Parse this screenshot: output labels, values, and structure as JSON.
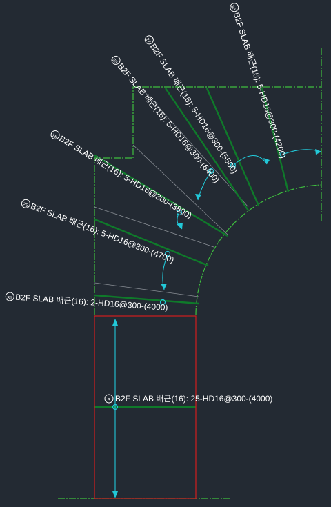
{
  "drawing": {
    "colors": {
      "background": "#232a33",
      "slab_outline": "#3fbf3f",
      "rebar_line": "#0f7a2a",
      "boundary_line": "#d21e1e",
      "leader_line": "#22c8d8",
      "guide_line": "#9a9a9a",
      "text": "#ffffff"
    },
    "labels": [
      {
        "id": "30",
        "text": "B2F SLAB 배근(16): 5-HD16@300-(4200)"
      },
      {
        "id": "27",
        "text": "B2F SLAB 배근(16): 5-HD16@300-(5500)"
      },
      {
        "id": "23",
        "text": "B2F SLAB 배근(16): 5-HD16@300-(6400)"
      },
      {
        "id": "18",
        "text": "B2F SLAB 배근(16): 5-HD16@300-(3800)"
      },
      {
        "id": "25",
        "text": "B2F SLAB 배근(16): 5-HD16@300-(4700)"
      },
      {
        "id": "31",
        "text": "B2F SLAB 배근(16): 2-HD16@300-(4000)"
      },
      {
        "id": "3",
        "text": "B2F SLAB 배근(16): 25-HD16@300-(4000)"
      }
    ]
  }
}
